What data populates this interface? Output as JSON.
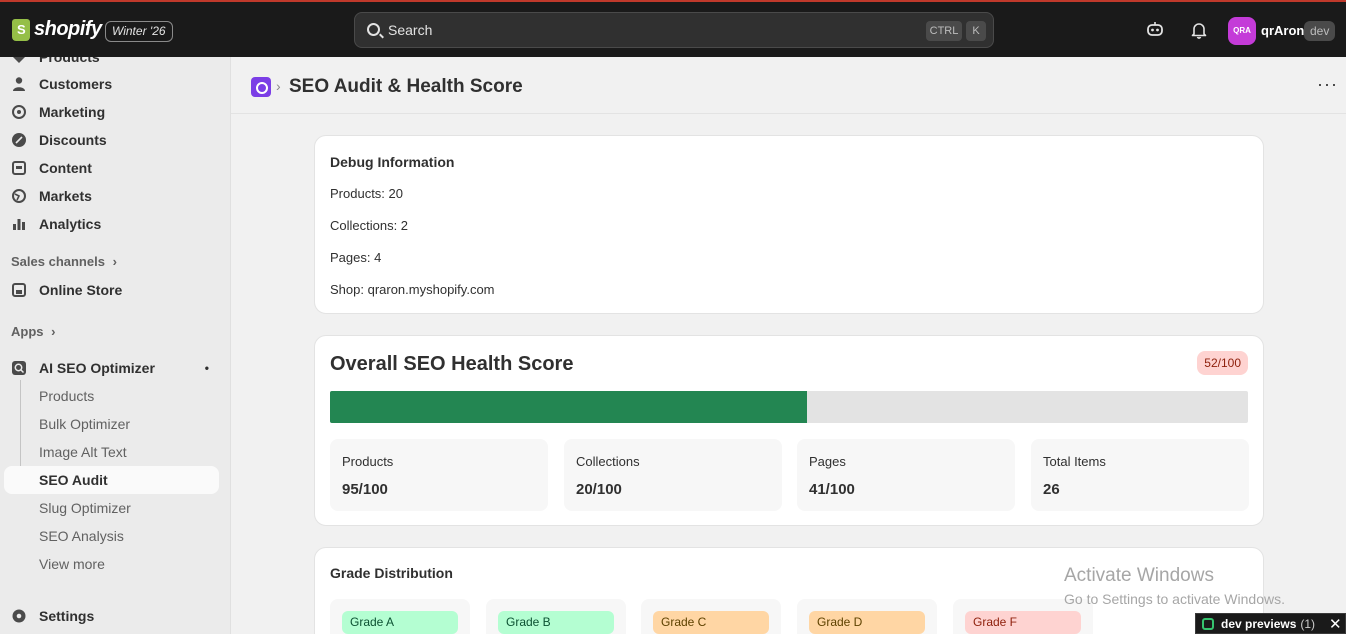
{
  "topbar": {
    "logo_text": "shopify",
    "edition": "Winter '26",
    "search_placeholder": "Search",
    "kbd_ctrl": "CTRL",
    "kbd_k": "K",
    "avatar_initials": "QRA",
    "store_name": "qrAron",
    "store_badge": "dev"
  },
  "sidebar": {
    "items_top": [
      {
        "label": "Products",
        "icon": "tag-icon"
      },
      {
        "label": "Customers",
        "icon": "person-icon"
      },
      {
        "label": "Marketing",
        "icon": "target-icon"
      },
      {
        "label": "Discounts",
        "icon": "discount-icon"
      },
      {
        "label": "Content",
        "icon": "content-icon"
      },
      {
        "label": "Markets",
        "icon": "globe-icon"
      },
      {
        "label": "Analytics",
        "icon": "bar-chart-icon"
      }
    ],
    "sales_channels_label": "Sales channels",
    "online_store": "Online Store",
    "apps_label": "Apps",
    "app_name": "AI SEO Optimizer",
    "app_pin": "•",
    "app_subitems": [
      "Products",
      "Bulk Optimizer",
      "Image Alt Text",
      "SEO Audit",
      "Slug Optimizer",
      "SEO Analysis",
      "View more"
    ],
    "settings": "Settings"
  },
  "header": {
    "breadcrumb_sep": "›",
    "title": "SEO Audit & Health Score",
    "menu": "···"
  },
  "debug": {
    "title": "Debug Information",
    "lines": [
      "Products: 20",
      "Collections: 2",
      "Pages: 4",
      "Shop: qraron.myshopify.com"
    ]
  },
  "health": {
    "title": "Overall SEO Health Score",
    "badge": "52/100",
    "score_fraction": 0.52,
    "stats": [
      {
        "label": "Products",
        "value": "95/100"
      },
      {
        "label": "Collections",
        "value": "20/100"
      },
      {
        "label": "Pages",
        "value": "41/100"
      },
      {
        "label": "Total Items",
        "value": "26"
      }
    ]
  },
  "grades": {
    "title": "Grade Distribution",
    "items": [
      {
        "label": "Grade A",
        "bg": "#b4fed2",
        "fg": "#0c5132"
      },
      {
        "label": "Grade B",
        "bg": "#b4fed2",
        "fg": "#0c5132"
      },
      {
        "label": "Grade C",
        "bg": "#ffd6a4",
        "fg": "#5e4200"
      },
      {
        "label": "Grade D",
        "bg": "#ffd6a4",
        "fg": "#5e4200"
      },
      {
        "label": "Grade F",
        "bg": "#fed3d1",
        "fg": "#8e1f0b"
      }
    ]
  },
  "watermark": {
    "line1": "Activate Windows",
    "line2": "Go to Settings to activate Windows."
  },
  "dev_previews": {
    "label": "dev previews",
    "count": "(1)",
    "close": "✕"
  }
}
